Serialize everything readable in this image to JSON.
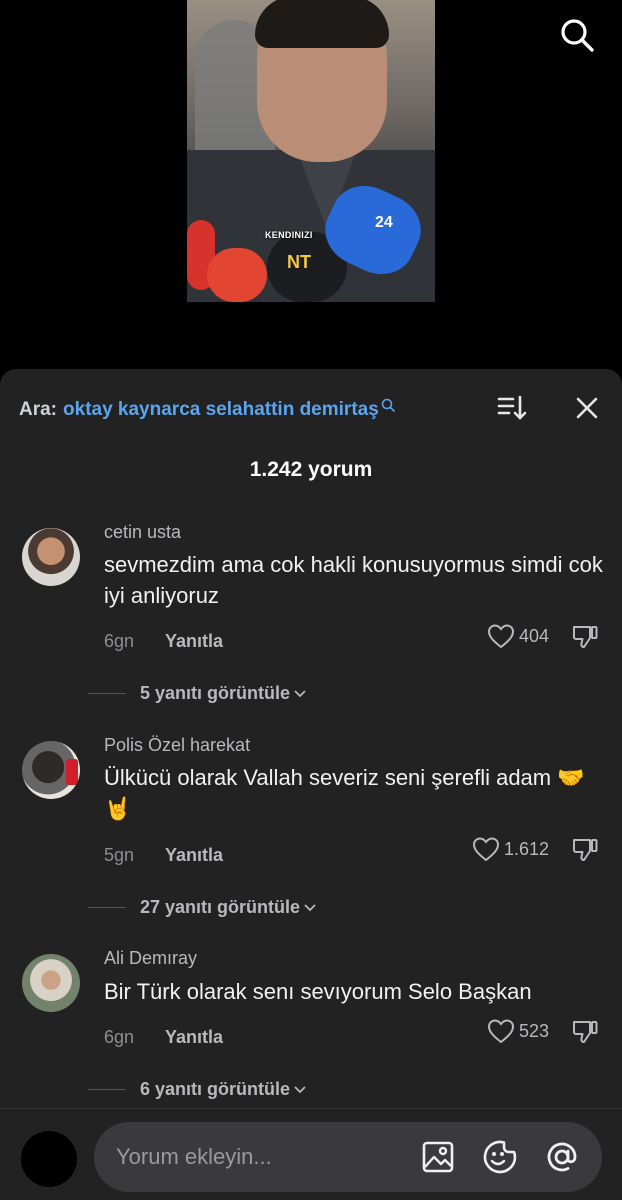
{
  "video": {
    "caption_text": "KENDINIZI",
    "mic_label_1": "NT",
    "mic_label_2": "24"
  },
  "search": {
    "prefix": "Ara:",
    "term": "oktay kaynarca selahattin demirtaş"
  },
  "comments_header": {
    "count_label": "1.242 yorum"
  },
  "comments": [
    {
      "username": "cetin usta",
      "text": "sevmezdim ama cok hakli konusuyormus simdi cok iyi anliyoruz",
      "date": "6gn",
      "reply_label": "Yanıtla",
      "likes": "404",
      "view_replies": "5 yanıtı görüntüle"
    },
    {
      "username": "Polis Özel harekat",
      "text": "Ülkücü olarak Vallah severiz seni şerefli adam 🤝🤘",
      "date": "5gn",
      "reply_label": "Yanıtla",
      "likes": "1.612",
      "view_replies": "27 yanıtı görüntüle"
    },
    {
      "username": "Ali Demıray",
      "text": "Bir Türk olarak senı sevıyorum Selo Başkan",
      "date": "6gn",
      "reply_label": "Yanıtla",
      "likes": "523",
      "view_replies": "6 yanıtı görüntüle"
    }
  ],
  "composer": {
    "placeholder": "Yorum ekleyin..."
  },
  "icons": {
    "top_search": "search-icon",
    "sort": "sort-icon",
    "close": "close-icon",
    "like": "heart-icon",
    "dislike": "thumbs-down-icon",
    "image": "image-icon",
    "emoji": "emoji-icon",
    "mention": "at-icon"
  },
  "colors": {
    "sheet_bg": "#222222",
    "search_term": "#5aa5ef",
    "text_primary": "#f1f1f1",
    "text_secondary": "#b9b9bd"
  }
}
